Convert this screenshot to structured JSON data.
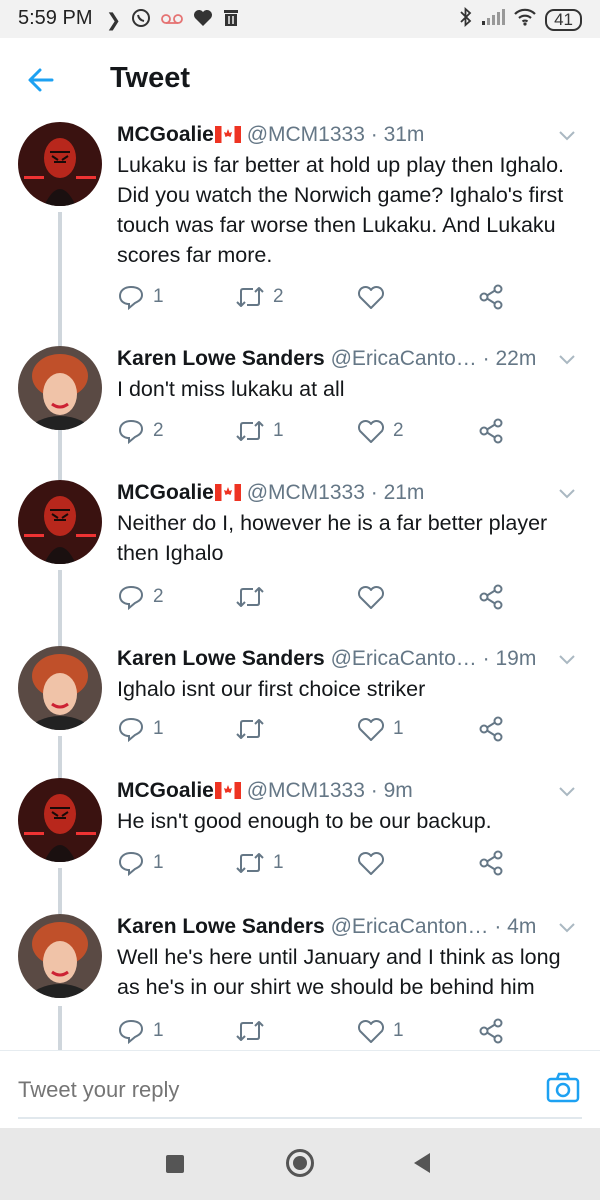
{
  "status_bar": {
    "time": "5:59 PM",
    "battery": "41",
    "left_icons": [
      "chevron-right-icon",
      "whatsapp-icon",
      "voicemail-icon",
      "heart-icon",
      "trash-icon"
    ],
    "right_icons": [
      "bluetooth-icon",
      "signal-icon",
      "wifi-icon"
    ]
  },
  "header": {
    "title": "Tweet"
  },
  "colors": {
    "accent": "#1da1f2",
    "text": "#14171a",
    "muted": "#657786",
    "thread_line": "#cfd6dc"
  },
  "tweets": [
    {
      "name": "MCGoalie",
      "flag": true,
      "handle": "@MCM1333",
      "sep": "·",
      "time": "31m",
      "text": "Lukaku is far better at hold up play then Ighalo. Did you watch the Norwich game? Ighalo's first touch was far worse then Lukaku. And Lukaku scores far more.",
      "replies": "1",
      "retweets": "2",
      "likes": "",
      "avatar": "darth-maul"
    },
    {
      "name": "Karen Lowe Sanders",
      "flag": false,
      "handle": "@EricaCanto…",
      "sep": "·",
      "time": "22m",
      "text": "I don't miss lukaku at all",
      "replies": "2",
      "retweets": "1",
      "likes": "2",
      "avatar": "woman"
    },
    {
      "name": "MCGoalie",
      "flag": true,
      "handle": "@MCM1333",
      "sep": "·",
      "time": "21m",
      "text": "Neither do I, however he is a far better player then Ighalo",
      "replies": "2",
      "retweets": "",
      "likes": "",
      "avatar": "darth-maul"
    },
    {
      "name": "Karen Lowe Sanders",
      "flag": false,
      "handle": "@EricaCanto…",
      "sep": "·",
      "time": "19m",
      "text": "Ighalo isnt our first choice striker",
      "replies": "1",
      "retweets": "",
      "likes": "1",
      "avatar": "woman"
    },
    {
      "name": "MCGoalie",
      "flag": true,
      "handle": "@MCM1333",
      "sep": "·",
      "time": "9m",
      "text": "He isn't good enough to be our backup.",
      "replies": "1",
      "retweets": "1",
      "likes": "",
      "avatar": "darth-maul"
    },
    {
      "name": "Karen Lowe Sanders",
      "flag": false,
      "handle": "@EricaCanton…",
      "sep": "·",
      "time": "4m",
      "text": "Well he's here until January and I think as long as he's in our shirt we should be behind him",
      "replies": "1",
      "retweets": "",
      "likes": "1",
      "avatar": "woman"
    }
  ],
  "reply": {
    "placeholder": "Tweet your reply"
  }
}
